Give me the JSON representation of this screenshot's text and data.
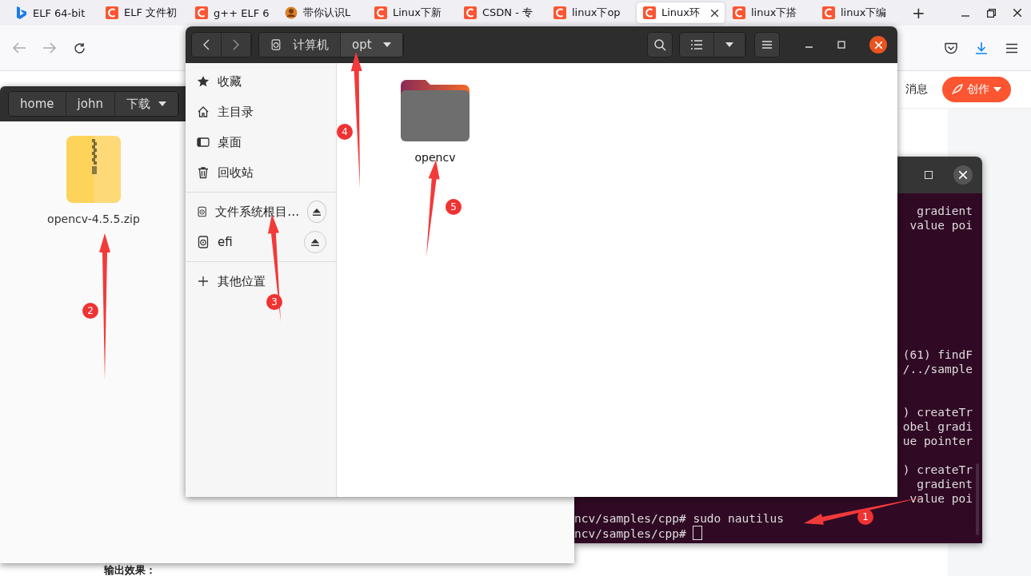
{
  "browser": {
    "tabs": [
      {
        "title": "ELF 64-bit",
        "kind": "bing",
        "selected": false
      },
      {
        "title": "ELF 文件初",
        "kind": "csdn",
        "selected": false
      },
      {
        "title": "g++ ELF 6",
        "kind": "csdn",
        "selected": false
      },
      {
        "title": "带你认识L",
        "kind": "avatar",
        "selected": false
      },
      {
        "title": "Linux下新",
        "kind": "csdn",
        "selected": false
      },
      {
        "title": "CSDN - 专",
        "kind": "csdn",
        "selected": false
      },
      {
        "title": "linux下op",
        "kind": "csdn",
        "selected": false
      },
      {
        "title": "Linux环",
        "kind": "csdn",
        "selected": true
      },
      {
        "title": "linux下搭",
        "kind": "csdn",
        "selected": false
      },
      {
        "title": "linux下编",
        "kind": "csdn",
        "selected": false
      }
    ],
    "new_tab": "+",
    "header": {
      "messages": "消息",
      "create_button": "创作"
    },
    "footer_text": "输出效果："
  },
  "files_window": {
    "path": [
      {
        "label": "home",
        "dropdown": false
      },
      {
        "label": "john",
        "dropdown": false
      },
      {
        "label": "下载",
        "dropdown": true
      }
    ],
    "files": [
      {
        "name": "opencv-4.5.5.zip",
        "kind": "zip"
      }
    ]
  },
  "terminal": {
    "blocks": [
      [
        "gradient",
        "value poi"
      ],
      [
        "(61) findF",
        "/../sample"
      ],
      [
        ") createTr",
        "obel gradi",
        "ue pointer"
      ],
      [
        ") createTr",
        "gradient",
        "value poi"
      ]
    ],
    "prompt_lines": [
      {
        "text": "ncv/samples/cpp# sudo nautilus",
        "cursor": false
      },
      {
        "text": "ncv/samples/cpp# ",
        "cursor": true
      }
    ]
  },
  "nautilus": {
    "path": [
      {
        "label": "计算机",
        "kind": "drive",
        "dropdown": false
      },
      {
        "label": "opt",
        "kind": "folder",
        "dropdown": true
      }
    ],
    "sidebar": [
      {
        "label": "收藏",
        "kind": "star"
      },
      {
        "label": "主目录",
        "kind": "home"
      },
      {
        "label": "桌面",
        "kind": "desktop"
      },
      {
        "label": "回收站",
        "kind": "trash"
      },
      {
        "label": "文件系统根目…",
        "kind": "drive"
      },
      {
        "label": "efi",
        "kind": "drive"
      },
      {
        "label": "其他位置",
        "kind": "other"
      }
    ],
    "items": [
      {
        "name": "opencv",
        "kind": "folder"
      }
    ]
  },
  "annotations": [
    {
      "label": "1"
    },
    {
      "label": "2"
    },
    {
      "label": "3"
    },
    {
      "label": "4"
    },
    {
      "label": "5"
    }
  ]
}
